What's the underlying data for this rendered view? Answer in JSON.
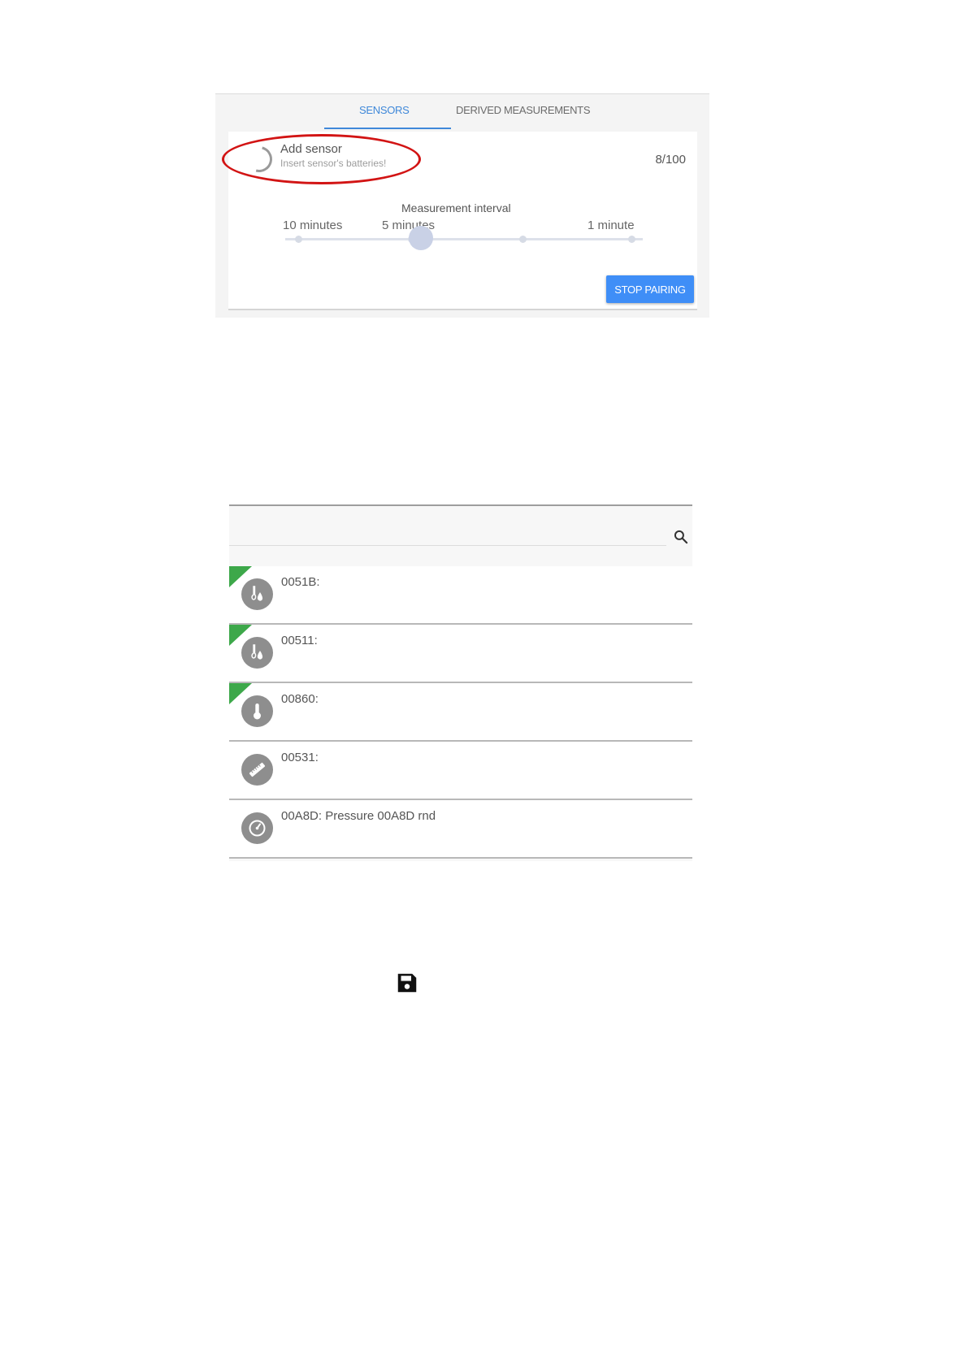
{
  "tabs": [
    {
      "label": "SENSORS",
      "active": true
    },
    {
      "label": "DERIVED MEASUREMENTS",
      "active": false
    }
  ],
  "pairing": {
    "title": "Add sensor",
    "subtitle": "Insert sensor's batteries!",
    "count": "8/100",
    "stop_label": "STOP PAIRING"
  },
  "interval": {
    "label": "Measurement interval",
    "options": [
      "10 minutes",
      "5 minutes",
      "1 minute"
    ],
    "selected": "5 minutes",
    "steps": 4,
    "selected_step": 1
  },
  "sensors": [
    {
      "label": "0051B:",
      "icon": "humidity-icon",
      "flagged": true
    },
    {
      "label": "00511:",
      "icon": "humidity-icon",
      "flagged": true
    },
    {
      "label": "00860:",
      "icon": "thermometer-icon",
      "flagged": true
    },
    {
      "label": "00531:",
      "icon": "ruler-icon",
      "flagged": false
    },
    {
      "label": "00A8D: Pressure 00A8D rnd",
      "icon": "pressure-gauge-icon",
      "flagged": false
    }
  ],
  "colors": {
    "accent": "#3f88d9",
    "button": "#3f8ef7",
    "flag": "#3da84a",
    "highlight": "#d21414"
  }
}
